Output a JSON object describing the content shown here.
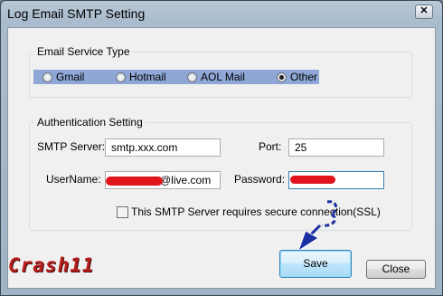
{
  "window": {
    "title": "Log Email SMTP Setting",
    "close_glyph": "✕"
  },
  "email_service": {
    "group_label": "Email Service Type",
    "options": [
      {
        "label": "Gmail",
        "selected": false
      },
      {
        "label": "Hotmail",
        "selected": false
      },
      {
        "label": "AOL Mail",
        "selected": false
      },
      {
        "label": "Other",
        "selected": true
      }
    ]
  },
  "auth": {
    "group_label": "Authentication Setting",
    "smtp_server": {
      "label": "SMTP Server:",
      "value": "smtp.xxx.com"
    },
    "port": {
      "label": "Port:",
      "value": "25"
    },
    "username": {
      "label": "UserName:",
      "value": "@live.com"
    },
    "password": {
      "label": "Password:",
      "value": ""
    },
    "ssl": {
      "label": "This SMTP Server requires secure connection(SSL)",
      "checked": false
    }
  },
  "buttons": {
    "save": "Save",
    "close": "Close"
  },
  "watermark": "Crash11",
  "colors": {
    "accent_blue": "#1a2fa0",
    "redaction_red": "#e0141a",
    "selection_strip": "#8ea7d6"
  }
}
